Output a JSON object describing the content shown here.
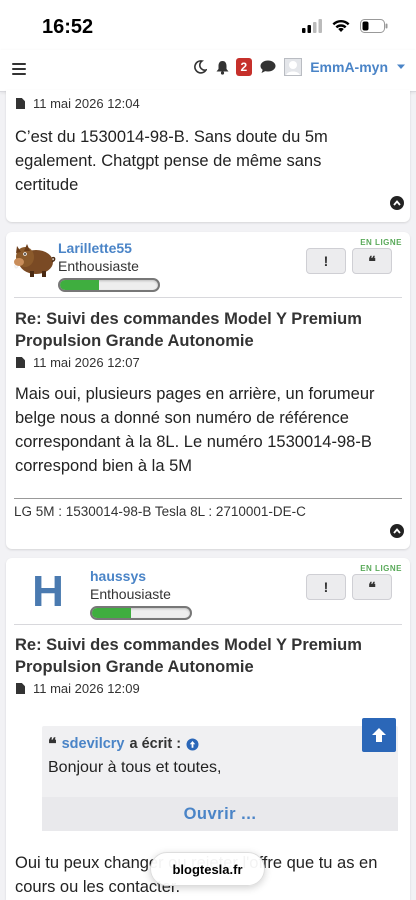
{
  "status_bar": {
    "time": "16:52"
  },
  "navbar": {
    "notifications_count": "2",
    "username": "EmmA-myn"
  },
  "posts": [
    {
      "date": "11 mai 2026 12:04",
      "body": "C’est du 1530014-98-B. Sans doute du 5m egalement. Chatgpt pense de même sans certitude"
    },
    {
      "author": "Larillette55",
      "rank": "Enthousiaste",
      "rank_progress": 0.4,
      "online_label": "EN LIGNE",
      "report_label": "!",
      "quote_label": "❝",
      "title": "Re: Suivi des commandes Model Y Premium Propulsion Grande Autonomie",
      "date": "11 mai 2026 12:07",
      "body": "Mais oui, plusieurs pages en arrière, un forumeur belge nous a donné son numéro de référence correspondant à la 8L. Le numéro 1530014-98-B correspond bien à la 5M",
      "signature": "LG 5M : 1530014-98-B Tesla 8L : 2710001-DE-C"
    },
    {
      "author": "haussys",
      "avatar_letter": "H",
      "rank": "Enthousiaste",
      "rank_progress": 0.4,
      "online_label": "EN LIGNE",
      "report_label": "!",
      "quote_label": "❝",
      "title": "Re: Suivi des commandes Model Y Premium Propulsion Grande Autonomie",
      "date": "11 mai 2026 12:09",
      "quote": {
        "author": "sdevilcry",
        "wrote": "a écrit :",
        "text": "Bonjour à tous et toutes,",
        "open_label": "Ouvrir ..."
      },
      "body": "Oui tu peux changer ou rejeter l'offre que tu as en cours ou les contacter."
    }
  ],
  "browser": {
    "url": "blogtesla.fr"
  },
  "colors": {
    "link": "#4a84c7",
    "accent": "#2b67b8",
    "online": "#5aaa5a",
    "badge": "#c6302b"
  }
}
